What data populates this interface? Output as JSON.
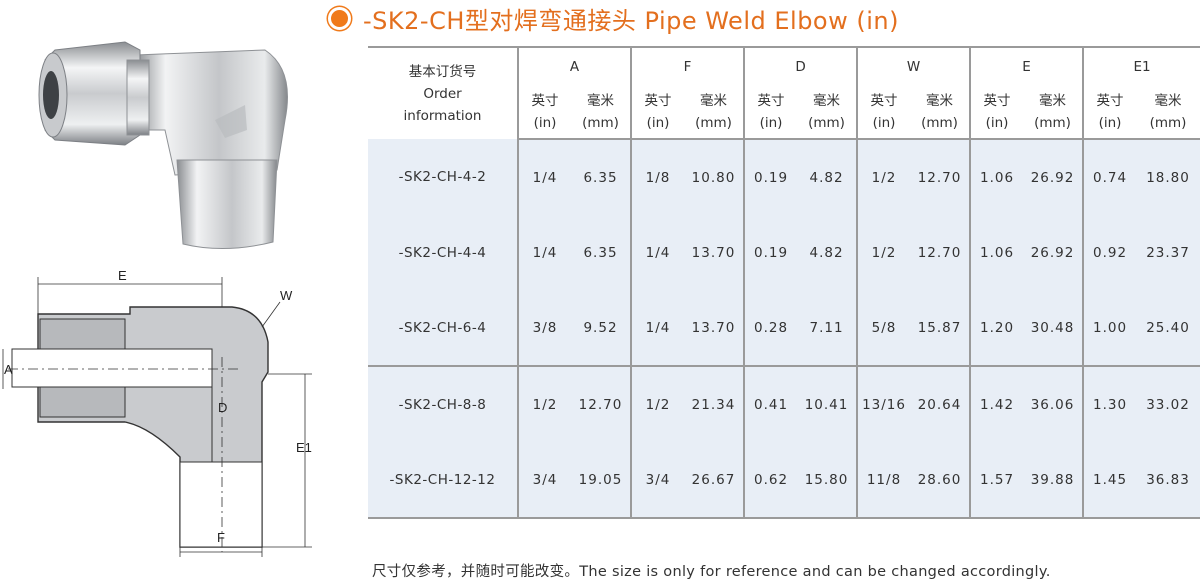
{
  "title": "-SK2-CH型对焊弯通接头 Pipe Weld Elbow (in)",
  "table": {
    "order_header_zh": "基本订货号",
    "order_header_en_1": "Order",
    "order_header_en_2": "information",
    "groups": [
      "A",
      "F",
      "D",
      "W",
      "E",
      "E1"
    ],
    "unit_in_zh": "英寸",
    "unit_in": "(in)",
    "unit_mm_zh": "毫米",
    "unit_mm": "(mm)",
    "rows": [
      {
        "model": "-SK2-CH-4-2",
        "vals": [
          "1/4",
          "6.35",
          "1/8",
          "10.80",
          "0.19",
          "4.82",
          "1/2",
          "12.70",
          "1.06",
          "26.92",
          "0.74",
          "18.80"
        ]
      },
      {
        "model": "-SK2-CH-4-4",
        "vals": [
          "1/4",
          "6.35",
          "1/4",
          "13.70",
          "0.19",
          "4.82",
          "1/2",
          "12.70",
          "1.06",
          "26.92",
          "0.92",
          "23.37"
        ]
      },
      {
        "model": "-SK2-CH-6-4",
        "vals": [
          "3/8",
          "9.52",
          "1/4",
          "13.70",
          "0.28",
          "7.11",
          "5/8",
          "15.87",
          "1.20",
          "30.48",
          "1.00",
          "25.40"
        ]
      },
      {
        "model": "-SK2-CH-8-8",
        "vals": [
          "1/2",
          "12.70",
          "1/2",
          "21.34",
          "0.41",
          "10.41",
          "13/16",
          "20.64",
          "1.42",
          "36.06",
          "1.30",
          "33.02"
        ]
      },
      {
        "model": "-SK2-CH-12-12",
        "vals": [
          "3/4",
          "19.05",
          "3/4",
          "26.67",
          "0.62",
          "15.80",
          "11/8",
          "28.60",
          "1.57",
          "39.88",
          "1.45",
          "36.83"
        ]
      }
    ]
  },
  "drawing_labels": {
    "E": "E",
    "W": "W",
    "A": "A",
    "D": "D",
    "E1": "E1",
    "F": "F"
  },
  "footnote": "尺寸仅参考，并随时可能改变。The size is only for reference and can be changed accordingly.",
  "colors": {
    "title": "#e36f1e",
    "table_bg": "#e8eef6",
    "rule": "#9a9a9a"
  }
}
